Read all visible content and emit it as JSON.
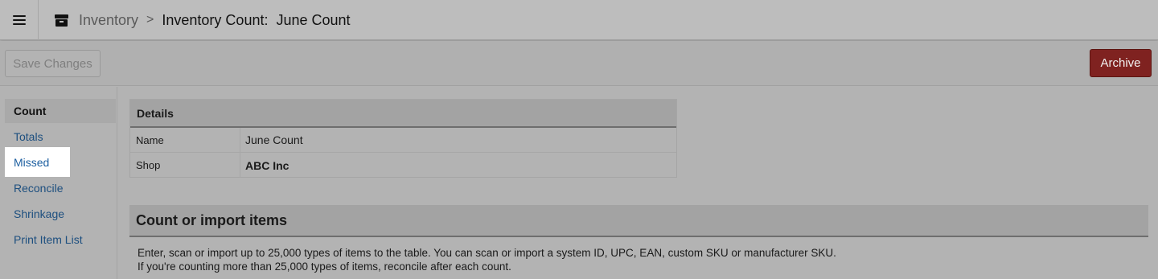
{
  "header": {
    "menu_icon": "hamburger-icon",
    "section_icon": "inventory-box-icon",
    "breadcrumb_parent": "Inventory",
    "breadcrumb_separator": ">",
    "breadcrumb_current": "Inventory Count:  June Count"
  },
  "toolbar": {
    "save_label": "Save Changes",
    "archive_label": "Archive",
    "archive_color": "#7f2220"
  },
  "sidebar": {
    "items": [
      {
        "label": "Count"
      },
      {
        "label": "Totals"
      },
      {
        "label": "Missed"
      },
      {
        "label": "Reconcile"
      },
      {
        "label": "Shrinkage"
      },
      {
        "label": "Print Item List"
      }
    ]
  },
  "details": {
    "title": "Details",
    "rows": [
      {
        "label": "Name",
        "value": "June Count"
      },
      {
        "label": "Shop",
        "value": "ABC Inc"
      }
    ]
  },
  "count_section": {
    "title": "Count or import items",
    "line1": "Enter, scan or import up to 25,000 types of items to the table. You can scan or import a system ID, UPC, EAN, custom SKU or manufacturer SKU.",
    "line2": "If you're counting more than 25,000 types of items, reconcile after each count."
  }
}
